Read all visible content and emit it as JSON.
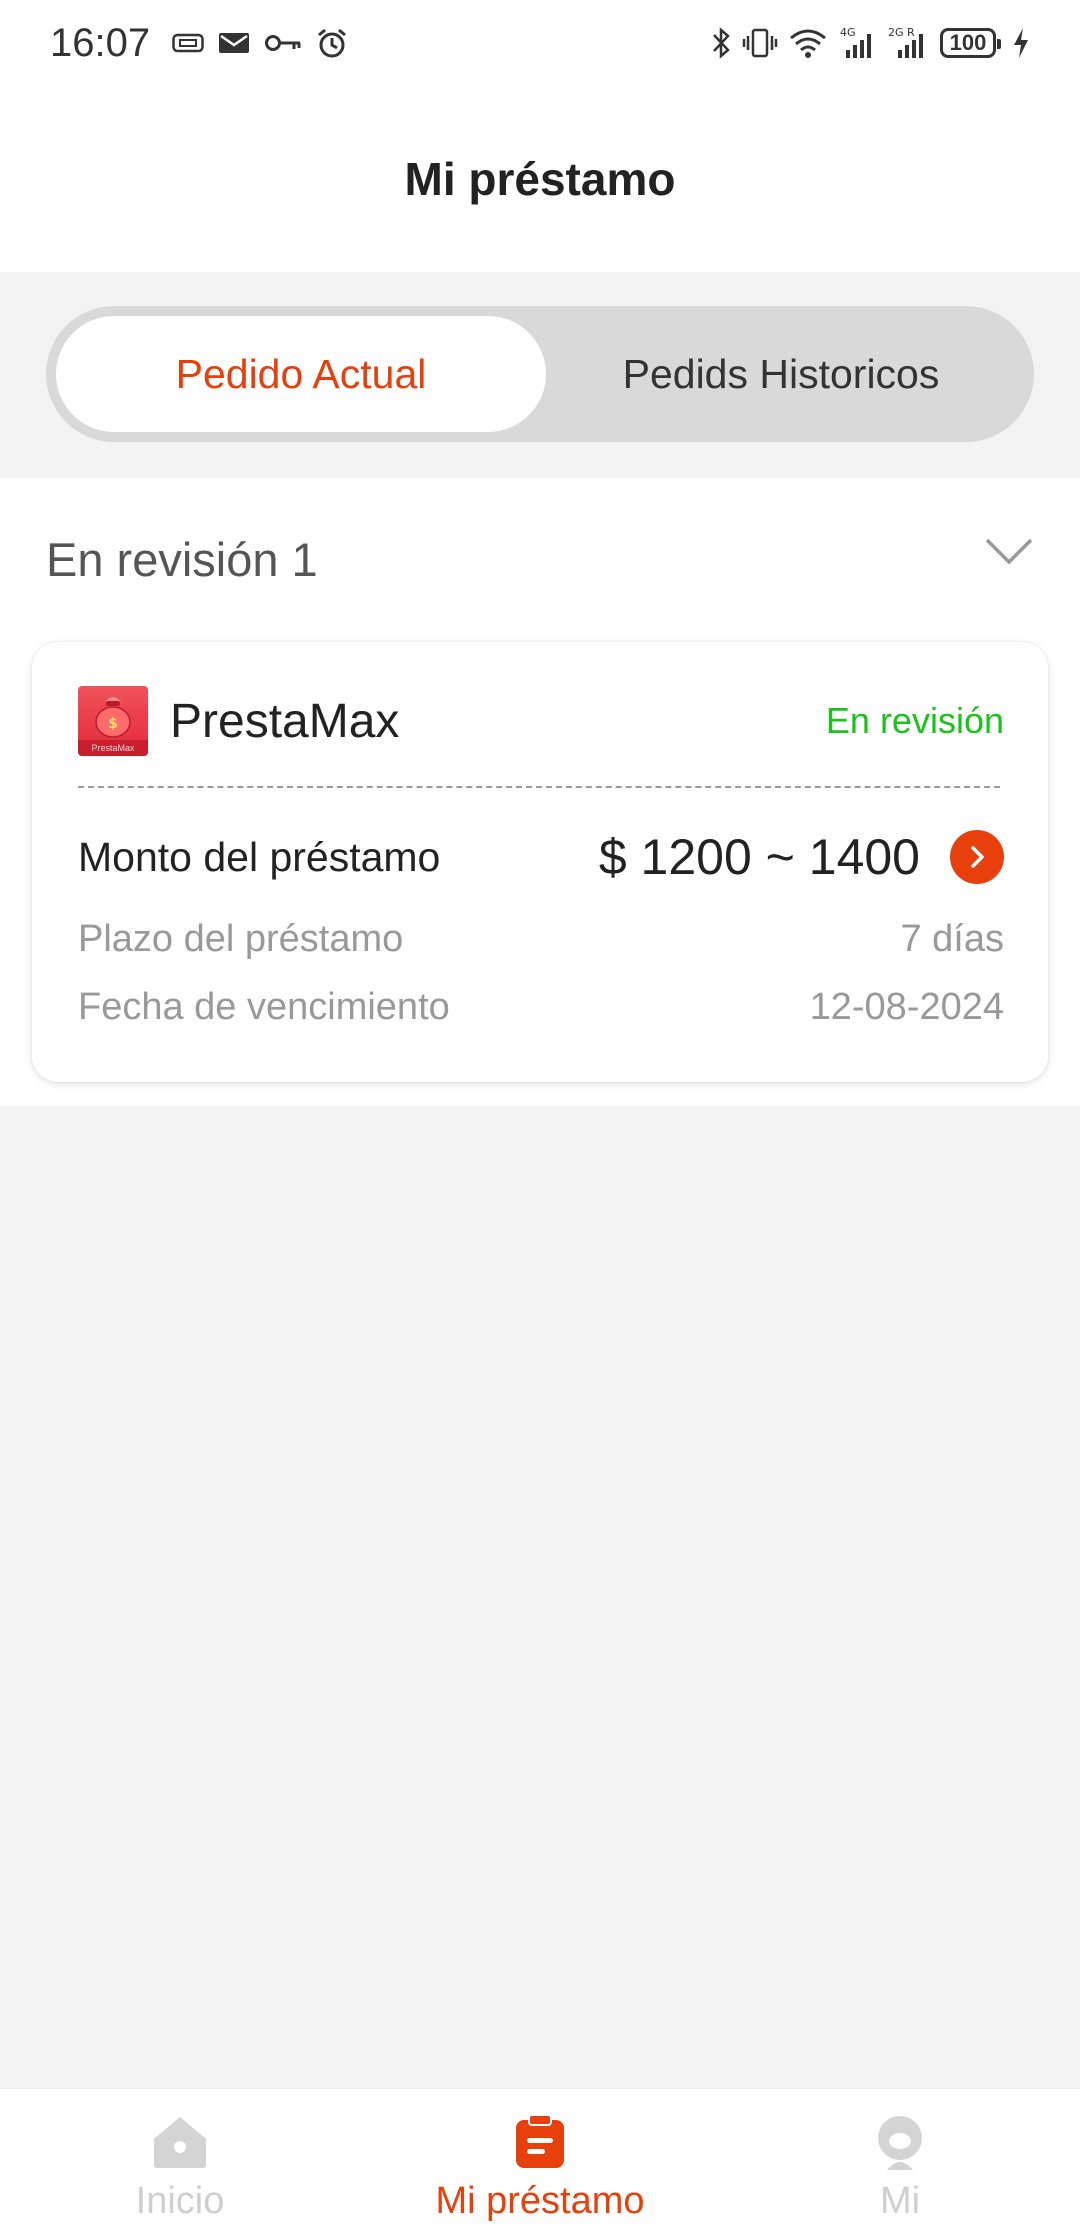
{
  "status_bar": {
    "time": "16:07",
    "battery": "100",
    "left_icons": [
      "sim-card-icon",
      "mail-icon",
      "key-icon",
      "alarm-icon"
    ],
    "right_icons": [
      "bluetooth-icon",
      "vibrate-icon",
      "wifi-icon",
      "signal-4g-icon",
      "signal-2g-icon",
      "battery-icon",
      "charging-icon"
    ]
  },
  "header": {
    "title": "Mi préstamo"
  },
  "tabs": [
    {
      "label": "Pedido Actual",
      "active": true
    },
    {
      "label": "Pedids Historicos",
      "active": false
    }
  ],
  "group": {
    "title": "En revisión 1"
  },
  "loan_card": {
    "app_name": "PrestaMax",
    "logo_text": "PrestaMax",
    "status": "En revisión",
    "amount_label": "Monto del préstamo",
    "amount_value": "$ 1200 ~ 1400",
    "term_label": "Plazo del préstamo",
    "term_value": "7 días",
    "due_label": "Fecha de vencimiento",
    "due_value": "12-08-2024"
  },
  "bottom_nav": [
    {
      "label": "Inicio",
      "icon": "home-icon",
      "active": false
    },
    {
      "label": "Mi préstamo",
      "icon": "clipboard-icon",
      "active": true
    },
    {
      "label": "Mi",
      "icon": "profile-icon",
      "active": false
    }
  ],
  "colors": {
    "accent": "#e8400c",
    "status_green": "#19c319",
    "background": "#f3f3f3",
    "inactive_nav": "#cfcfcf"
  }
}
